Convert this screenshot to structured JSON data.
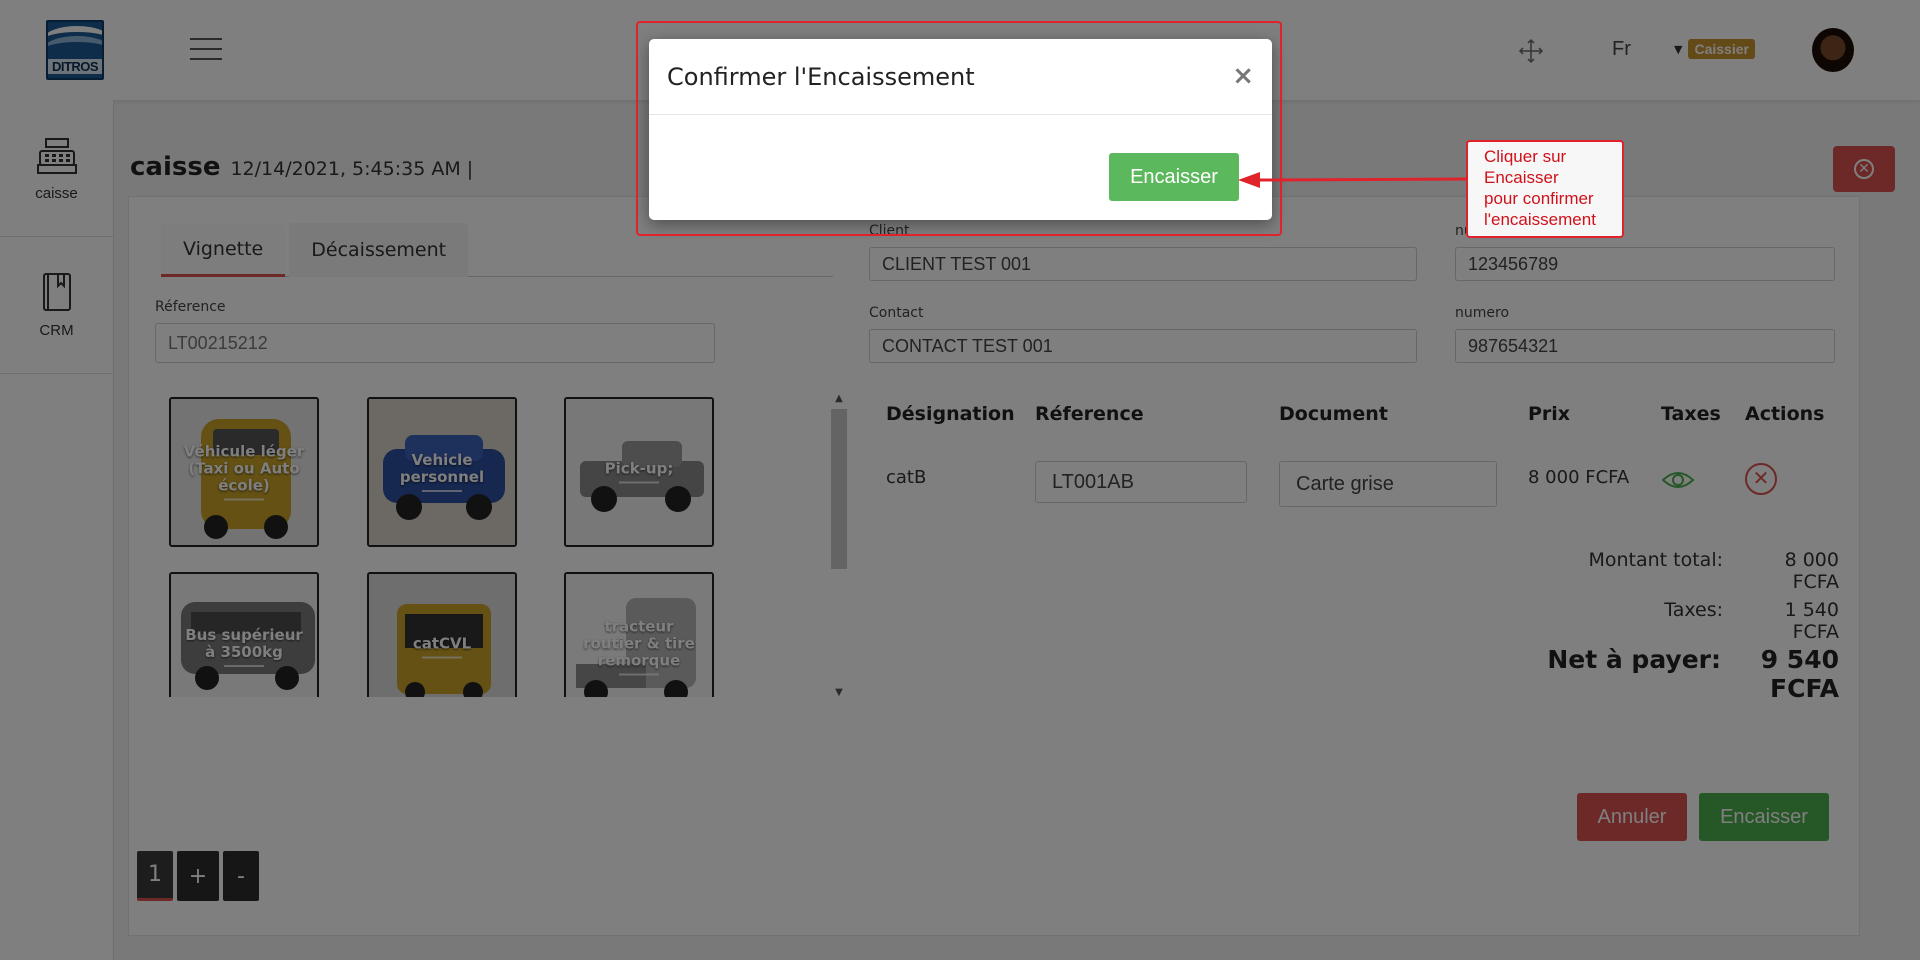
{
  "header": {
    "logo_text": "DITROS",
    "language": "Fr",
    "role_badge": "Caissier"
  },
  "sidebar": {
    "items": [
      {
        "label": "caisse",
        "icon": "cash-register-icon"
      },
      {
        "label": "CRM",
        "icon": "book-icon"
      }
    ]
  },
  "page": {
    "title": "caisse",
    "datetime": "12/14/2021, 5:45:35 AM |"
  },
  "tabs": [
    {
      "label": "Vignette",
      "active": true
    },
    {
      "label": "Décaissement",
      "active": false
    }
  ],
  "reference": {
    "label": "Réference",
    "value": "LT00215212"
  },
  "vehicle_tiles": [
    {
      "label": "Véhicule léger (Taxi ou Auto école)",
      "color": "#c9a227"
    },
    {
      "label": "Vehicle personnel",
      "color": "#2c4fa0"
    },
    {
      "label": "Pick-up;",
      "color": "#8a8a8a"
    },
    {
      "label": "Bus supérieur à 3500kg",
      "color": "#7b7b7b"
    },
    {
      "label": "catCVL",
      "color": "#c9a227"
    },
    {
      "label": "tracteur routier & tire remorque",
      "color": "#9a9a9a"
    }
  ],
  "pager": {
    "current": "1",
    "plus": "+",
    "minus": "-"
  },
  "client": {
    "client_label": "Client",
    "client_value": "CLIENT TEST 001",
    "numero_label_1": "numero",
    "numero_value_1": "123456789",
    "contact_label": "Contact",
    "contact_value": "CONTACT TEST 001",
    "numero_label_2": "numero",
    "numero_value_2": "987654321"
  },
  "table": {
    "headers": [
      "Désignation",
      "Réference",
      "Document",
      "Prix",
      "Taxes",
      "Actions"
    ],
    "rows": [
      {
        "designation": "catB",
        "reference": "LT001AB",
        "document": "Carte grise",
        "prix": "8 000 FCFA"
      }
    ]
  },
  "summary": {
    "total_label": "Montant total:",
    "total_value": "8 000 FCFA",
    "taxes_label": "Taxes:",
    "taxes_value": "1 540 FCFA",
    "net_label": "Net à payer:",
    "net_value": "9 540 FCFA"
  },
  "actions": {
    "cancel_label": "Annuler",
    "cash_label": "Encaisser"
  },
  "modal": {
    "title": "Confirmer l'Encaissement",
    "close": "×",
    "confirm_label": "Encaisser"
  },
  "annotation": {
    "line1": "Cliquer sur",
    "line2": "Encaisser",
    "line3": "pour confirmer",
    "line4": "l'encaissement"
  },
  "colors": {
    "accent_red": "#d9534f",
    "accent_green": "#5cb85c",
    "annotation_red": "#e0232b",
    "badge": "#c8942f"
  }
}
